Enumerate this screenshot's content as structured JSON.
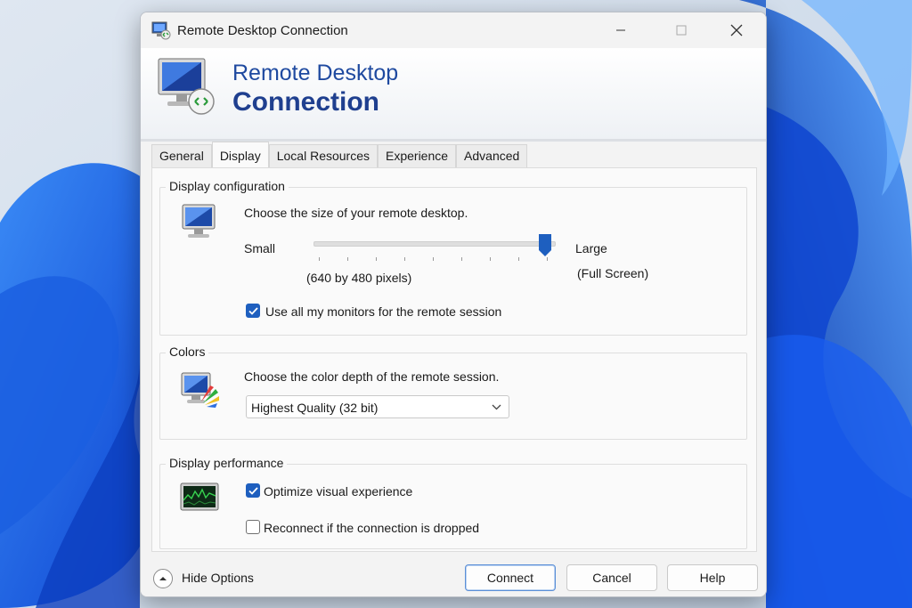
{
  "window": {
    "title": "Remote Desktop Connection",
    "controls": {
      "minimize": "minimize",
      "maximize": "maximize",
      "close": "close"
    }
  },
  "banner": {
    "line1": "Remote Desktop",
    "line2": "Connection"
  },
  "tabs": [
    {
      "label": "General",
      "active": false
    },
    {
      "label": "Display",
      "active": true
    },
    {
      "label": "Local Resources",
      "active": false
    },
    {
      "label": "Experience",
      "active": false
    },
    {
      "label": "Advanced",
      "active": false
    }
  ],
  "display_config": {
    "group_title": "Display configuration",
    "instruction": "Choose the size of your remote desktop.",
    "slider_min_label": "Small",
    "slider_max_label": "Large",
    "slider_value_fraction": 1.0,
    "current_size_text": "(640 by 480 pixels)",
    "max_size_text": "(Full Screen)",
    "monitors_checkbox": {
      "label": "Use all my monitors for the remote session",
      "checked": true
    }
  },
  "colors": {
    "group_title": "Colors",
    "instruction": "Choose the color depth of the remote session.",
    "selected_value": "Highest Quality (32 bit)"
  },
  "performance": {
    "group_title": "Display performance",
    "optimize_checkbox": {
      "label": "Optimize visual experience",
      "checked": true
    },
    "reconnect_checkbox": {
      "label": "Reconnect if the connection is dropped",
      "checked": false
    }
  },
  "footer": {
    "hide_options_label": "Hide Options",
    "connect_label": "Connect",
    "cancel_label": "Cancel",
    "help_label": "Help"
  },
  "theme": {
    "accent": "#1e5fbf",
    "banner_text": "#1f4aa0"
  }
}
